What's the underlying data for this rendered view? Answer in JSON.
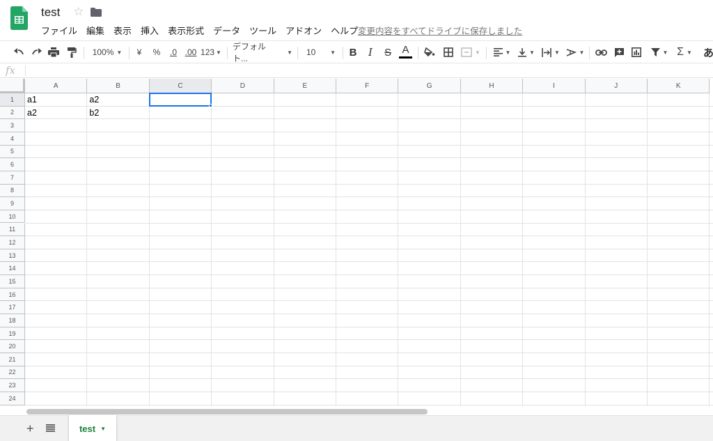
{
  "header": {
    "title": "test",
    "menu": [
      "ファイル",
      "編集",
      "表示",
      "挿入",
      "表示形式",
      "データ",
      "ツール",
      "アドオン",
      "ヘルプ"
    ],
    "save_status": "変更内容をすべてドライブに保存しました"
  },
  "toolbar": {
    "zoom": "100%",
    "currency": "¥",
    "percent": "%",
    "decimal_decrease": ".0",
    "decimal_increase": ".00",
    "number_format": "123",
    "font": "デフォルト...",
    "font_size": "10",
    "bold": "B",
    "italic": "I",
    "strikethrough": "S",
    "text_color": "A",
    "input_tools": "あ"
  },
  "formula_bar": {
    "label": "fx",
    "value": ""
  },
  "grid": {
    "columns": [
      "A",
      "B",
      "C",
      "D",
      "E",
      "F",
      "G",
      "H",
      "I",
      "J",
      "K"
    ],
    "rows": [
      "1",
      "2",
      "3",
      "4",
      "5",
      "6",
      "7",
      "8",
      "9",
      "10",
      "11",
      "12",
      "13",
      "14",
      "15",
      "16",
      "17",
      "18",
      "19",
      "20",
      "21",
      "22",
      "23",
      "24"
    ],
    "selected_cell": "C1",
    "cells": [
      {
        "ref": "A1",
        "value": "a1"
      },
      {
        "ref": "B1",
        "value": "a2"
      },
      {
        "ref": "A2",
        "value": "a2"
      },
      {
        "ref": "B2",
        "value": "b2"
      }
    ]
  },
  "sheets": {
    "add_label": "+",
    "active": "test"
  },
  "colors": {
    "accent": "#1a73e8",
    "sheets_green": "#188038"
  }
}
